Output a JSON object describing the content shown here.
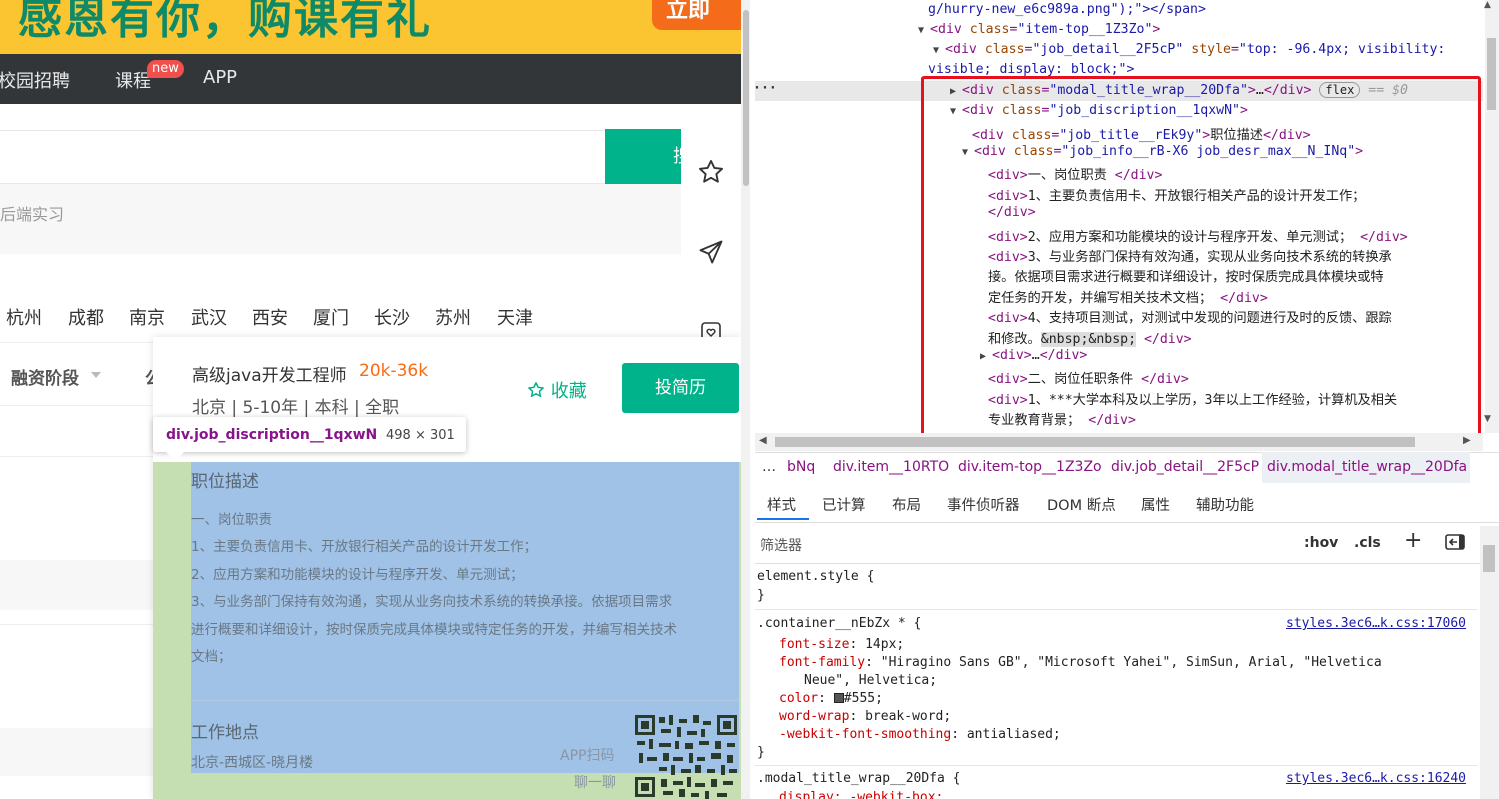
{
  "banner": {
    "text": "感恩有你，购课有礼",
    "button": "立即"
  },
  "nav": {
    "items": [
      "校园招聘",
      "课程",
      "APP"
    ],
    "badge": "new"
  },
  "search": {
    "button_label": "搜",
    "hint": "后端实习"
  },
  "cities": [
    "杭州",
    "成都",
    "南京",
    "武汉",
    "西安",
    "厦门",
    "长沙",
    "苏州",
    "天津"
  ],
  "filters": {
    "funding": "融资阶段",
    "next": "公"
  },
  "job": {
    "title": "高级java开发工程师",
    "salary": "20k-36k",
    "meta": "北京 | 5-10年 | 本科 | 全职",
    "collect": "收藏",
    "apply": "投简历",
    "desc_title": "职位描述",
    "desc_lines": [
      "一、岗位职责",
      "1、主要负责信用卡、开放银行相关产品的设计开发工作；",
      "2、应用方案和功能模块的设计与程序开发、单元测试；",
      "3、与业务部门保持有效沟通，实现从业务向技术系统的转换承接。依据项目需求",
      "进行概要和详细设计，按时保质完成具体模块或特定任务的开发，并编写相关技术",
      "文档；"
    ],
    "loc_title": "工作地点",
    "loc_value": "北京-西城区-晓月楼",
    "app_scan": "APP扫码",
    "app_chat": "聊一聊"
  },
  "tooltip": {
    "selector": "div.job_discription__1qxwN",
    "size": "498 × 301"
  },
  "devtools": {
    "dom": {
      "l0": "g/hurry-new_e6c989a.png\");\"></span>",
      "l1_tag": "div",
      "l1_attr": "class",
      "l1_val": "\"item-top__1Z3Zo\"",
      "l2_tag": "div",
      "l2_attr1": "class",
      "l2_val1": "\"job_detail__2F5cP\"",
      "l2_attr2": "style",
      "l2_val2": "\"top: -96.4px; visibility:",
      "l2b": "visible; display: block;\">",
      "l3_tag": "div",
      "l3_attr": "class",
      "l3_val": "\"modal_title_wrap__20Dfa\"",
      "l3_flex": "flex",
      "l3_eq": "== $0",
      "l4_tag": "div",
      "l4_attr": "class",
      "l4_val": "\"job_discription__1qxwN\"",
      "l5_attr": "class",
      "l5_val": "\"job_title__rEk9y\"",
      "l5_text": "职位描述",
      "l6_attr": "class",
      "l6_val": "\"job_info__rB-X6 job_desr_max__N_INq\"",
      "lines": [
        "一、岗位职责 ",
        "1、主要负责信用卡、开放银行相关产品的设计开发工作；",
        "2、应用方案和功能模块的设计与程序开发、单元测试； ",
        "3、与业务部门保持有效沟通，实现从业务向技术系统的转换承",
        "接。依据项目需求进行概要和详细设计，按时保质完成具体模块或特",
        "定任务的开发，并编写相关技术文档； ",
        "4、支持项目测试，对测试中发现的问题进行及时的反馈、跟踪",
        "和修改。",
        "二、岗位任职条件 ",
        "1、***大学本科及以上学历，3年以上工作经验，计算机及相关",
        "专业教育背景； "
      ],
      "nbsp": "&nbsp;&nbsp;",
      "ellipsis": "…"
    },
    "breadcrumbs": [
      "…",
      "bNq",
      "div.item__10RTO",
      "div.item-top__1Z3Zo",
      "div.job_detail__2F5cP",
      "div.modal_title_wrap__20Dfa"
    ],
    "tabs": [
      "样式",
      "已计算",
      "布局",
      "事件侦听器",
      "DOM 断点",
      "属性",
      "辅助功能"
    ],
    "filter_placeholder": "筛选器",
    "hov": ":hov",
    "cls": ".cls",
    "styles": {
      "element_style": "element.style {",
      "close": "}",
      "rule1_selector": ".container__nEbZx * {",
      "rule1_source": "styles.3ec6…k.css:17060",
      "rule1_props": [
        {
          "name": "font-size",
          "value": "14px;"
        },
        {
          "name": "font-family",
          "value": "\"Hiragino Sans GB\", \"Microsoft Yahei\", SimSun, Arial, \"Helvetica"
        },
        {
          "name": "",
          "value": "Neue\", Helvetica;"
        },
        {
          "name": "color",
          "value": "#555;"
        },
        {
          "name": "word-wrap",
          "value": "break-word;"
        },
        {
          "name": "-webkit-font-smoothing",
          "value": "antialiased;"
        }
      ],
      "rule2_selector": ".modal_title_wrap__20Dfa {",
      "rule2_source": "styles.3ec6…k.css:16240",
      "rule2_prop": "display: -webkit-box;"
    }
  },
  "colors": {
    "accent": "#00b38a",
    "salary": "#fa6b14",
    "highlight_content": "#9fc2e6",
    "highlight_padding": "#c5dfb3",
    "devtools_red": "#e8101c",
    "tag": "#881280",
    "attr": "#994500",
    "value": "#1a1aa6"
  }
}
